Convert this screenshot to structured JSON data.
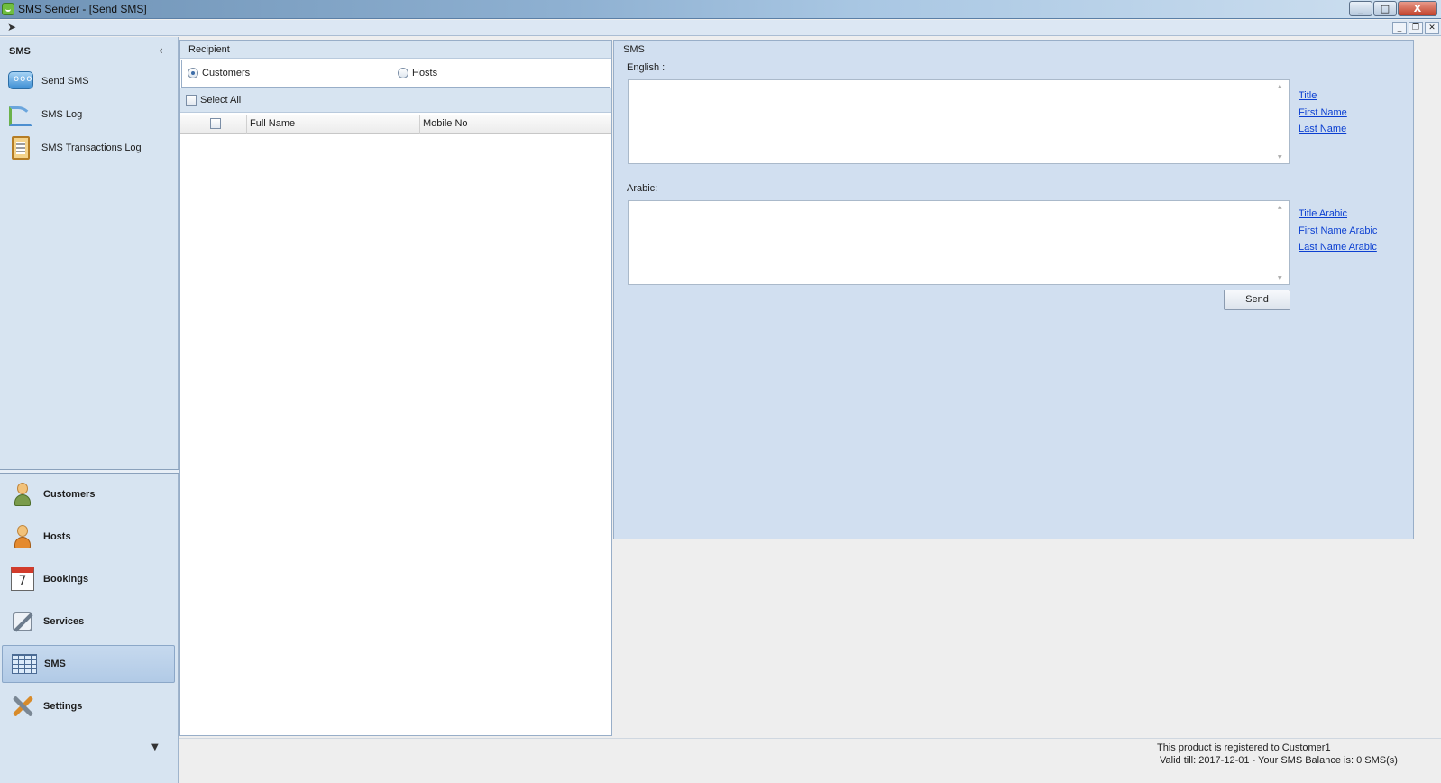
{
  "window": {
    "title": "SMS Sender - [Send SMS]",
    "buttons": {
      "minimize": "_",
      "maximize": "□",
      "close": "X"
    }
  },
  "mdi": {
    "minimize": "_",
    "restore": "❐",
    "close": "✕"
  },
  "nav": {
    "header": "SMS",
    "items": [
      {
        "label": "Send SMS",
        "icon": "chat-bubble-icon"
      },
      {
        "label": "SMS Log",
        "icon": "chart-signal-icon"
      },
      {
        "label": "SMS Transactions Log",
        "icon": "clipboard-icon"
      }
    ],
    "groups": [
      {
        "label": "Customers",
        "icon": "customer-person-icon"
      },
      {
        "label": "Hosts",
        "icon": "host-person-icon"
      },
      {
        "label": "Bookings",
        "icon": "calendar-icon",
        "calendar_day": "7"
      },
      {
        "label": "Services",
        "icon": "services-wrench-icon"
      },
      {
        "label": "SMS",
        "icon": "grid-table-icon",
        "active": true
      },
      {
        "label": "Settings",
        "icon": "tools-icon"
      }
    ]
  },
  "recipient": {
    "header": "Recipient",
    "radio_customers": "Customers",
    "radio_hosts": "Hosts",
    "selected": "Customers",
    "select_all": "Select All",
    "columns": [
      "Full Name",
      "Mobile No"
    ],
    "rows": []
  },
  "sms": {
    "header": "SMS",
    "english_label": "English :",
    "english_value": "",
    "arabic_label": "Arabic:",
    "arabic_value": "",
    "english_tokens": [
      "Title",
      "First Name",
      "Last Name"
    ],
    "arabic_tokens": [
      "Title Arabic",
      "First Name Arabic",
      "Last Name Arabic"
    ],
    "send_label": "Send"
  },
  "status": {
    "line1": "This product is registered to Customer1",
    "line2": "Valid till: 2017-12-01 - Your SMS Balance is: 0 SMS(s)"
  },
  "colors": {
    "panel_bg": "#d1dff0",
    "nav_bg": "#d7e4f1",
    "link": "#0b3fd1"
  }
}
